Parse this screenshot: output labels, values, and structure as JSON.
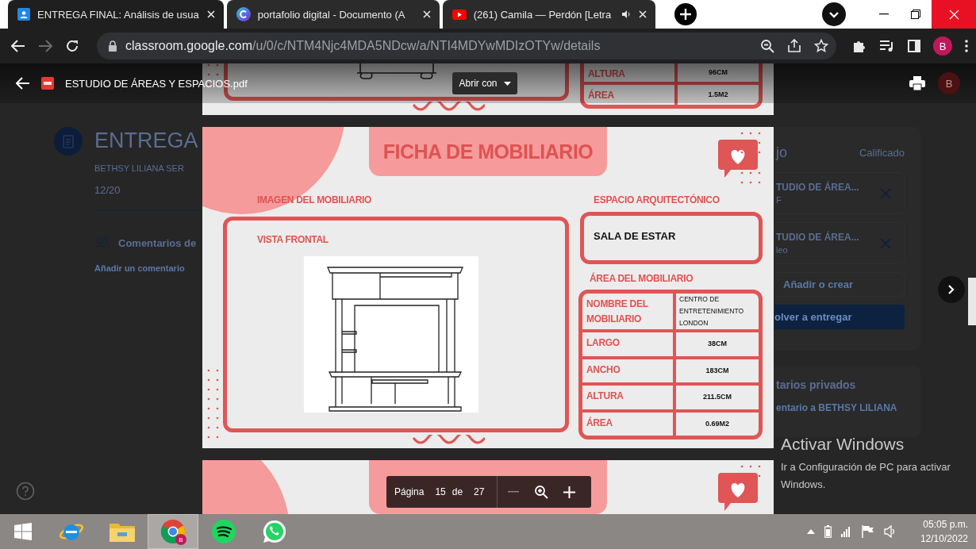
{
  "browser": {
    "tabs": [
      {
        "title": "ENTREGA FINAL: Análisis de usua",
        "kind": "classroom",
        "selected": true,
        "audio": false
      },
      {
        "title": "portafolio digital - Documento (A",
        "kind": "canva",
        "selected": false,
        "audio": false
      },
      {
        "title": "(261) Camila — Perdón [Letra",
        "kind": "youtube",
        "selected": false,
        "audio": true
      }
    ],
    "forward_disabled": true,
    "url_host": "classroom.google.com",
    "url_path": "/u/0/c/NTM4Njc4MDA5NDcw/a/NTI4MDYwMDIzOTYw/details",
    "profile_initial": "B"
  },
  "classroom": {
    "title": "ENTREGA",
    "student": "BETHSY LILIANA SER",
    "grade": "12/20",
    "comments_heading": "Comentarios de",
    "add_comment": "Añadir un comentario",
    "work": {
      "heading": "jo",
      "status": "Calificado",
      "attachments": [
        {
          "name": "TUDIO DE ÁREA...",
          "type": "F"
        },
        {
          "name": "TUDIO DE ÁREA...",
          "type": "leo"
        }
      ],
      "add": "Añadir o crear",
      "submit": "olver a entregar"
    },
    "private": {
      "heading": "tarios privados",
      "add": "entario a BETHSY LILIANA"
    }
  },
  "viewer": {
    "file_name": "ESTUDIO DE ÁREAS Y ESPACIOS.pdf",
    "open_with": "Abrir con",
    "avatar_initial": "B",
    "previous_page": {
      "rows": [
        {
          "label": "ALTURA",
          "value": "96CM"
        },
        {
          "label": "ÁREA",
          "value": "1.5M2"
        }
      ]
    },
    "page": {
      "title": "FICHA DE MOBILIARIO",
      "image_heading": "IMAGEN DEL MOBILIARIO",
      "view_label": "VISTA FRONTAL",
      "space_heading": "ESPACIO ARQUITECTÓNICO",
      "space": "SALA DE ESTAR",
      "area_heading": "ÁREA DEL MOBILIARIO",
      "rows": [
        {
          "label": "NOMBRE DEL MOBILIARIO",
          "value": "CENTRO DE ENTRETENIMIENTO LONDON"
        },
        {
          "label": "LARGO",
          "value": "38CM"
        },
        {
          "label": "ANCHO",
          "value": "183CM"
        },
        {
          "label": "ALTURA",
          "value": "211.5CM"
        },
        {
          "label": "ÁREA",
          "value": "0.69M2"
        }
      ]
    },
    "toolbar": {
      "page_label": "Página",
      "page": "15",
      "of": "de",
      "total": "27"
    }
  },
  "os": {
    "activation": {
      "title": "Activar Windows",
      "text": "Ir a Configuración de PC para activar Windows."
    },
    "taskbar": {
      "apps": [
        {
          "kind": "start",
          "selected": false
        },
        {
          "kind": "ie",
          "selected": false
        },
        {
          "kind": "explorer",
          "selected": false
        },
        {
          "kind": "chrome",
          "selected": true,
          "badge": "B"
        },
        {
          "kind": "spotify",
          "selected": false
        },
        {
          "kind": "whatsapp",
          "selected": false
        }
      ],
      "time": "05:05 p.m.",
      "date": "12/10/2022"
    }
  }
}
